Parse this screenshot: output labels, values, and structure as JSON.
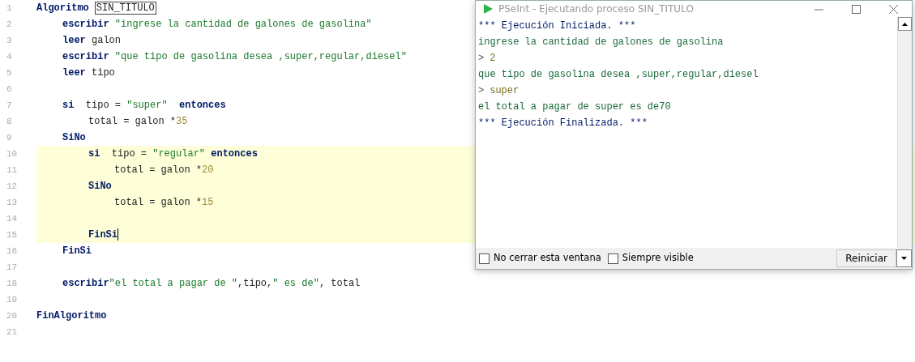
{
  "editor": {
    "lines": [
      {
        "number": "1",
        "tokens": [
          {
            "text": "Algoritmo",
            "kind": "keyword"
          },
          {
            "text": "SIN_TITULO",
            "kind": "name"
          }
        ],
        "children": [
          {
            "number": "2",
            "tokens": [
              {
                "text": "escribir",
                "kind": "keyword"
              },
              {
                "text": " \"ingrese la cantidad de galones de gasolina\"",
                "kind": "string"
              }
            ]
          },
          {
            "number": "3",
            "tokens": [
              {
                "text": "leer",
                "kind": "keyword"
              },
              {
                "text": " galon",
                "kind": "plain"
              }
            ]
          },
          {
            "number": "4",
            "tokens": [
              {
                "text": "escribir",
                "kind": "keyword"
              },
              {
                "text": " \"que tipo de gasolina desea ,super,regular,diesel\"",
                "kind": "string"
              }
            ]
          },
          {
            "number": "5",
            "tokens": [
              {
                "text": "leer",
                "kind": "keyword"
              },
              {
                "text": " tipo",
                "kind": "plain"
              }
            ]
          },
          {
            "number": "6"
          },
          {
            "number": "7",
            "tokens": [
              {
                "text": "si",
                "kind": "keyword"
              },
              {
                "text": "  tipo = ",
                "kind": "plain"
              },
              {
                "text": "\"super\"",
                "kind": "string"
              },
              {
                "text": "  entonces",
                "kind": "keyword"
              }
            ],
            "children": [
              {
                "number": "8",
                "tokens": [
                  {
                    "text": "total = galon *",
                    "kind": "plain"
                  },
                  {
                    "text": "35",
                    "kind": "number"
                  }
                ]
              }
            ]
          },
          {
            "number": "9",
            "tokens": [
              {
                "text": "SiNo",
                "kind": "keyword"
              }
            ],
            "children": [
              {
                "number": "10",
                "highlighted": true,
                "tokens": [
                  {
                    "text": "si",
                    "kind": "keyword"
                  },
                  {
                    "text": "  tipo = ",
                    "kind": "plain"
                  },
                  {
                    "text": "\"regular\"",
                    "kind": "string"
                  },
                  {
                    "text": " entonces",
                    "kind": "keyword"
                  }
                ],
                "children": [
                  {
                    "number": "11",
                    "highlighted": true,
                    "tokens": [
                      {
                        "text": "total = galon *",
                        "kind": "plain"
                      },
                      {
                        "text": "20",
                        "kind": "number"
                      }
                    ]
                  }
                ]
              },
              {
                "number": "12",
                "highlighted": true,
                "tokens": [
                  {
                    "text": "SiNo",
                    "kind": "keyword"
                  }
                ],
                "children": [
                  {
                    "number": "13",
                    "highlighted": true,
                    "tokens": [
                      {
                        "text": "total = galon *",
                        "kind": "plain"
                      },
                      {
                        "text": "15",
                        "kind": "number"
                      }
                    ]
                  },
                  {
                    "number": "14",
                    "highlighted": true
                  }
                ]
              },
              {
                "number": "15",
                "highlighted": true,
                "cursor": true,
                "tokens": [
                  {
                    "text": "FinSi",
                    "kind": "keyword"
                  }
                ]
              }
            ]
          },
          {
            "number": "16",
            "tokens": [
              {
                "text": "FinSi",
                "kind": "keyword"
              }
            ]
          },
          {
            "number": "17"
          },
          {
            "number": "18",
            "tokens": [
              {
                "text": "escribir",
                "kind": "keyword"
              },
              {
                "text": "\"el total a pagar de \"",
                "kind": "string"
              },
              {
                "text": ",tipo,",
                "kind": "plain"
              },
              {
                "text": "\" es de\"",
                "kind": "string"
              },
              {
                "text": ", total",
                "kind": "plain"
              }
            ]
          },
          {
            "number": "19"
          }
        ]
      },
      {
        "number": "20",
        "tokens": [
          {
            "text": "FinAlgoritmo",
            "kind": "keyword"
          }
        ]
      },
      {
        "number": "21"
      }
    ]
  },
  "console_window": {
    "title": "PSeInt - Ejecutando proceso SIN_TITULO",
    "lines": [
      {
        "kind": "system",
        "text": "*** Ejecución Iniciada. ***"
      },
      {
        "kind": "output",
        "text": "ingrese la cantidad de galones de gasolina"
      },
      {
        "kind": "input",
        "prompt": ">",
        "text": "2"
      },
      {
        "kind": "output",
        "text": "que tipo de gasolina desea ,super,regular,diesel"
      },
      {
        "kind": "input",
        "prompt": ">",
        "text": "super"
      },
      {
        "kind": "output",
        "text": "el total a pagar de super es de70"
      },
      {
        "kind": "system",
        "text": "*** Ejecución Finalizada. ***"
      }
    ],
    "options": [
      {
        "label": "No cerrar esta ventana",
        "checked": false
      },
      {
        "label": "Siempre visible",
        "checked": false
      }
    ],
    "button": "Reiniciar"
  }
}
